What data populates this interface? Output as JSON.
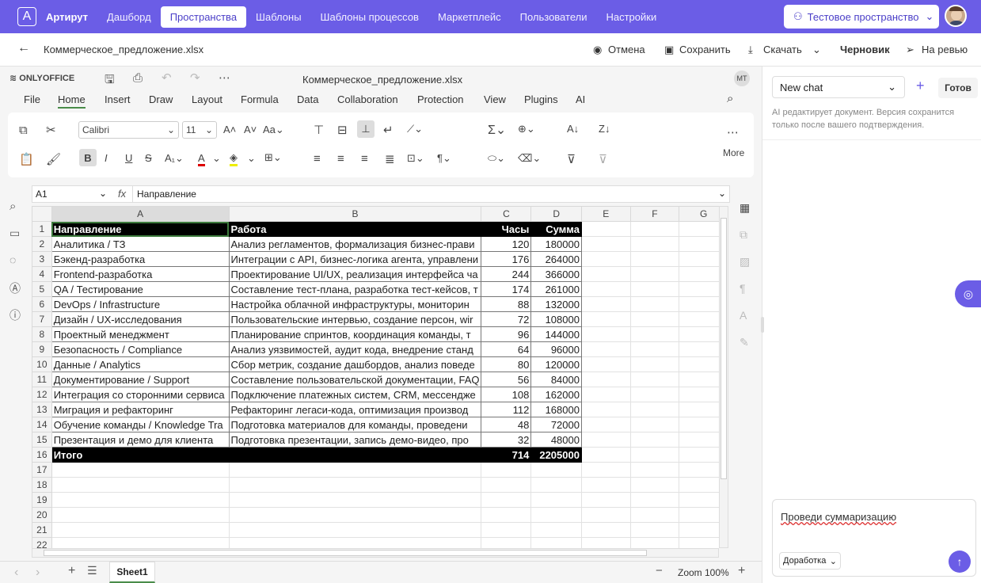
{
  "topbar": {
    "brand": "Артирут",
    "nav": [
      "Дашборд",
      "Пространства",
      "Шаблоны",
      "Шаблоны процессов",
      "Маркетплейс",
      "Пользователи",
      "Настройки"
    ],
    "active": "Пространства",
    "space": "Тестовое пространство"
  },
  "filebar": {
    "filename": "Коммерческое_предложение.xlsx",
    "cancel": "Отмена",
    "save": "Сохранить",
    "download": "Скачать",
    "draft": "Черновик",
    "review": "На ревью"
  },
  "editor": {
    "product": "ONLYOFFICE",
    "doc_title": "Коммерческое_предложение.xlsx",
    "user_initials": "МТ",
    "menu": [
      "File",
      "Home",
      "Insert",
      "Draw",
      "Layout",
      "Formula",
      "Data",
      "Collaboration",
      "Protection",
      "View",
      "Plugins",
      "AI"
    ],
    "active_menu": "Home",
    "font": "Calibri",
    "font_size": "11",
    "more": "More",
    "cell_ref": "A1",
    "formula": "Направление",
    "sheet_tab": "Sheet1",
    "zoom": "Zoom 100%"
  },
  "sheet": {
    "columns": [
      "A",
      "B",
      "C",
      "D",
      "E",
      "F",
      "G"
    ],
    "header": [
      "Направление",
      "Работа",
      "Часы",
      "Сумма"
    ],
    "rows": [
      [
        "Аналитика / ТЗ",
        "Анализ регламентов, формализация бизнес-прави",
        "120",
        "180000"
      ],
      [
        "Бэкенд-разработка",
        "Интеграции с API, бизнес-логика агента, управлени",
        "176",
        "264000"
      ],
      [
        "Frontend-разработка",
        "Проектирование UI/UX, реализация интерфейса ча",
        "244",
        "366000"
      ],
      [
        "QA / Тестирование",
        "Составление тест-плана, разработка тест-кейсов, т",
        "174",
        "261000"
      ],
      [
        "DevOps / Infrastructure",
        "Настройка облачной инфраструктуры, мониторин",
        "88",
        "132000"
      ],
      [
        "Дизайн / UX-исследования",
        "Пользовательские интервью, создание персон, wir",
        "72",
        "108000"
      ],
      [
        "Проектный менеджмент",
        "Планирование спринтов, координация команды, т",
        "96",
        "144000"
      ],
      [
        "Безопасность / Compliance",
        "Анализ уязвимостей, аудит кода, внедрение станд",
        "64",
        "96000"
      ],
      [
        "Данные / Analytics",
        "Сбор метрик, создание дашбордов, анализ поведе",
        "80",
        "120000"
      ],
      [
        "Документирование / Support",
        "Составление пользовательской документации, FAQ",
        "56",
        "84000"
      ],
      [
        "Интеграция со сторонними сервиса",
        "Подключение платежных систем, CRM, мессендже",
        "108",
        "162000"
      ],
      [
        "Миграция и рефакторинг",
        "Рефакторинг легаси-кода, оптимизация производ",
        "112",
        "168000"
      ],
      [
        "Обучение команды / Knowledge Tra",
        "Подготовка материалов для команды, проведени",
        "48",
        "72000"
      ],
      [
        "Презентация и демо для клиента",
        "Подготовка презентации, запись демо-видео, про",
        "32",
        "48000"
      ]
    ],
    "total": [
      "Итого",
      "",
      "714",
      "2205000"
    ],
    "row_numbers": [
      "1",
      "2",
      "3",
      "4",
      "5",
      "6",
      "7",
      "8",
      "9",
      "10",
      "11",
      "12",
      "13",
      "14",
      "15",
      "16",
      "17",
      "18",
      "19",
      "20",
      "21",
      "22"
    ]
  },
  "chat": {
    "select": "New chat",
    "ready": "Готов",
    "notice": "AI редактирует документ. Версия сохранится только после вашего подтверждения.",
    "input": "Проведи суммаризацию",
    "mode": "Доработка"
  }
}
